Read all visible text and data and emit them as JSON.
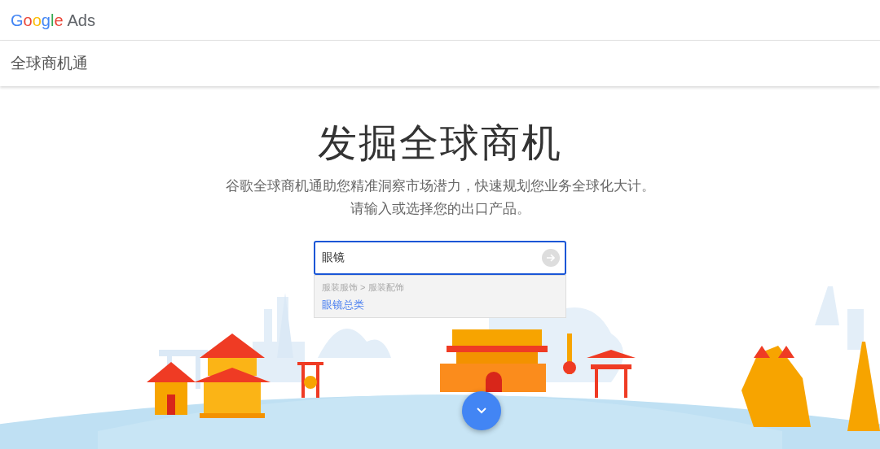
{
  "header": {
    "logo_brand": "Google",
    "logo_product": "Ads"
  },
  "subheader": {
    "title": "全球商机通"
  },
  "hero": {
    "heading": "发掘全球商机",
    "subtitle_lines": [
      "谷歌全球商机通助您精准洞察市场潜力，快速规划您业务全球化大计。",
      "请输入或选择您的出口产品。"
    ]
  },
  "search": {
    "value": "眼镜"
  },
  "suggestions": [
    {
      "path": "服装服饰 > 服装配饰",
      "label": "眼镜总类"
    }
  ]
}
